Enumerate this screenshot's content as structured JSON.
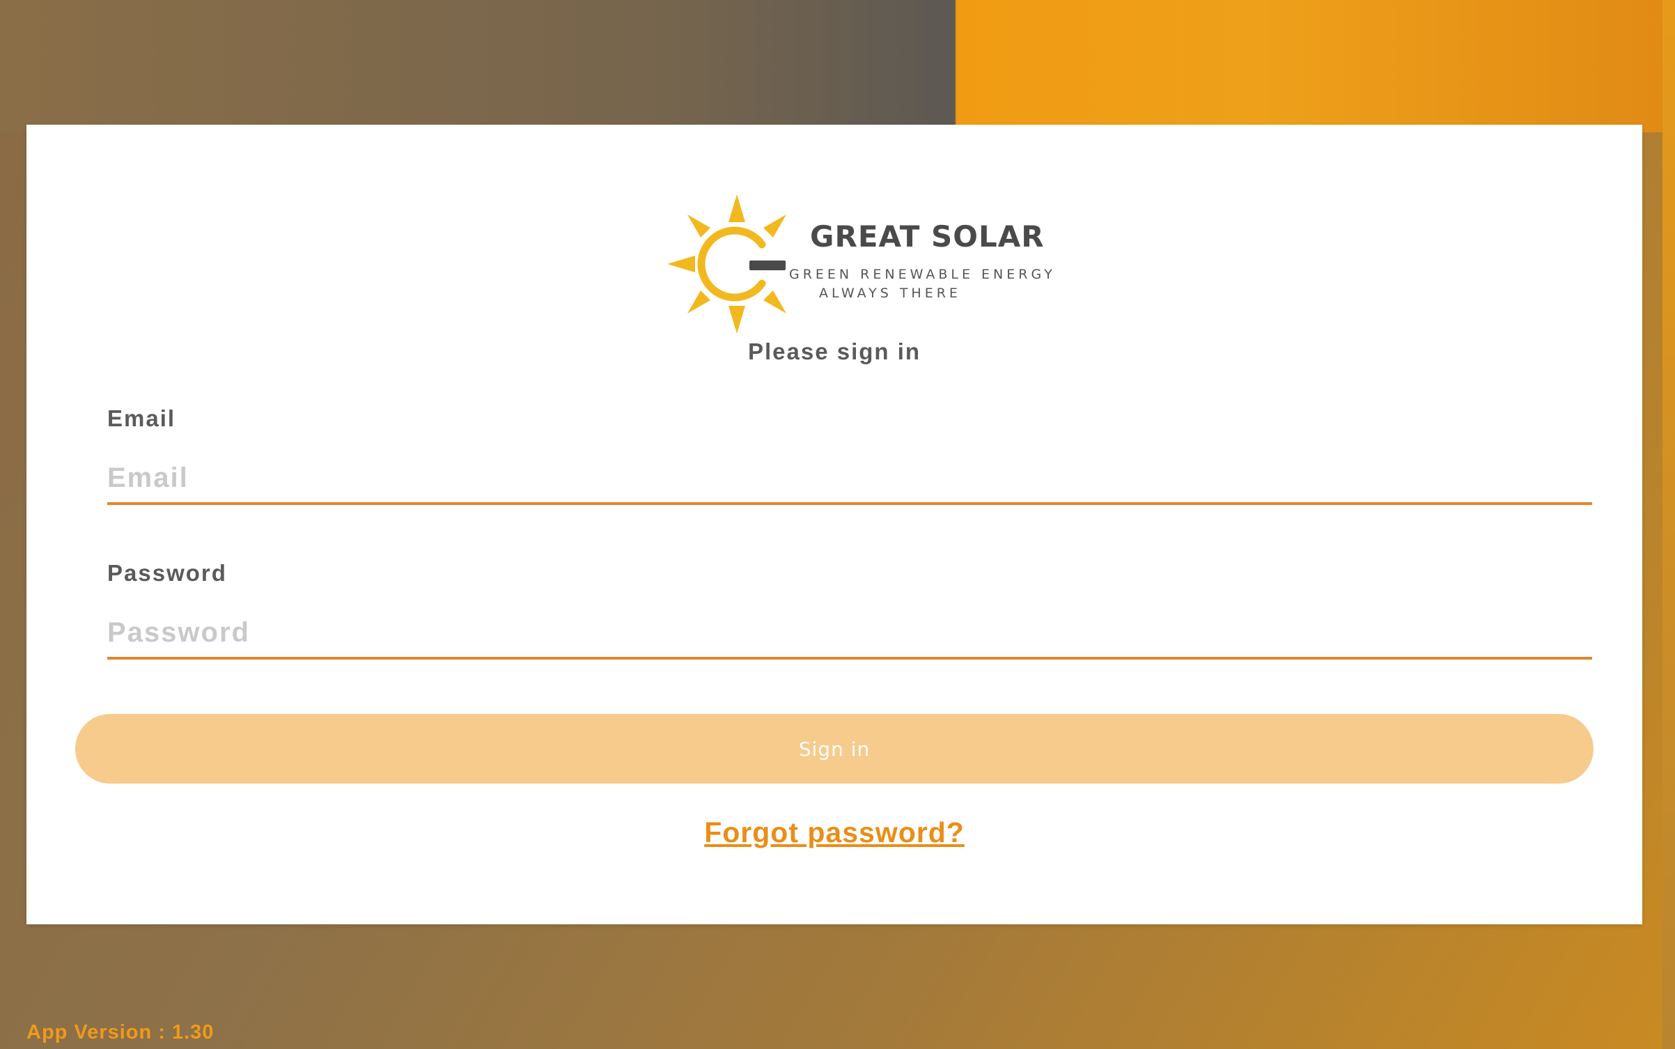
{
  "brand": {
    "name": "GREAT SOLAR",
    "tagline_line1": "GREEN RENEWABLE ENERGY",
    "tagline_line2": "ALWAYS THERE",
    "logo_icon": "sun-logo-icon"
  },
  "form": {
    "subtitle": "Please sign in",
    "email": {
      "label": "Email",
      "placeholder": "Email",
      "value": ""
    },
    "password": {
      "label": "Password",
      "placeholder": "Password",
      "value": ""
    },
    "signin_label": "Sign in",
    "forgot_label": "Forgot password?"
  },
  "footer": {
    "app_version": "App Version : 1.30"
  },
  "colors": {
    "accent": "#ea8e18",
    "button_disabled": "#f7cb8c",
    "text_muted": "#5a5a5a",
    "placeholder": "#c9c9c9",
    "sun_yellow": "#f2b91e"
  }
}
